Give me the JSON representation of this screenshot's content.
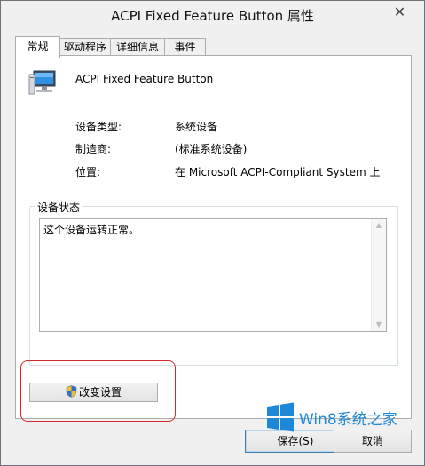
{
  "window": {
    "title": "ACPI Fixed Feature Button 属性",
    "close_glyph": "✕"
  },
  "tabs": [
    {
      "label": "常规",
      "active": true
    },
    {
      "label": "驱动程序",
      "active": false
    },
    {
      "label": "详细信息",
      "active": false
    },
    {
      "label": "事件",
      "active": false
    }
  ],
  "device": {
    "icon": "computer-icon",
    "name": "ACPI Fixed Feature Button"
  },
  "properties": [
    {
      "label": "设备类型:",
      "value": "系统设备"
    },
    {
      "label": "制造商:",
      "value": "(标准系统设备)"
    },
    {
      "label": "位置:",
      "value": "在 Microsoft ACPI-Compliant System 上"
    }
  ],
  "status_group": {
    "title": "设备状态",
    "text": "这个设备运转正常。"
  },
  "change_settings": {
    "label": "改变设置",
    "icon": "uac-shield-icon"
  },
  "buttons": {
    "save": "保存(S)",
    "cancel": "取消"
  },
  "watermark": {
    "text": "Win8系统之家",
    "color": "#1e88d8"
  },
  "colors": {
    "highlight_border": "#d22a2a",
    "default_button_border": "#3c7fb1"
  }
}
